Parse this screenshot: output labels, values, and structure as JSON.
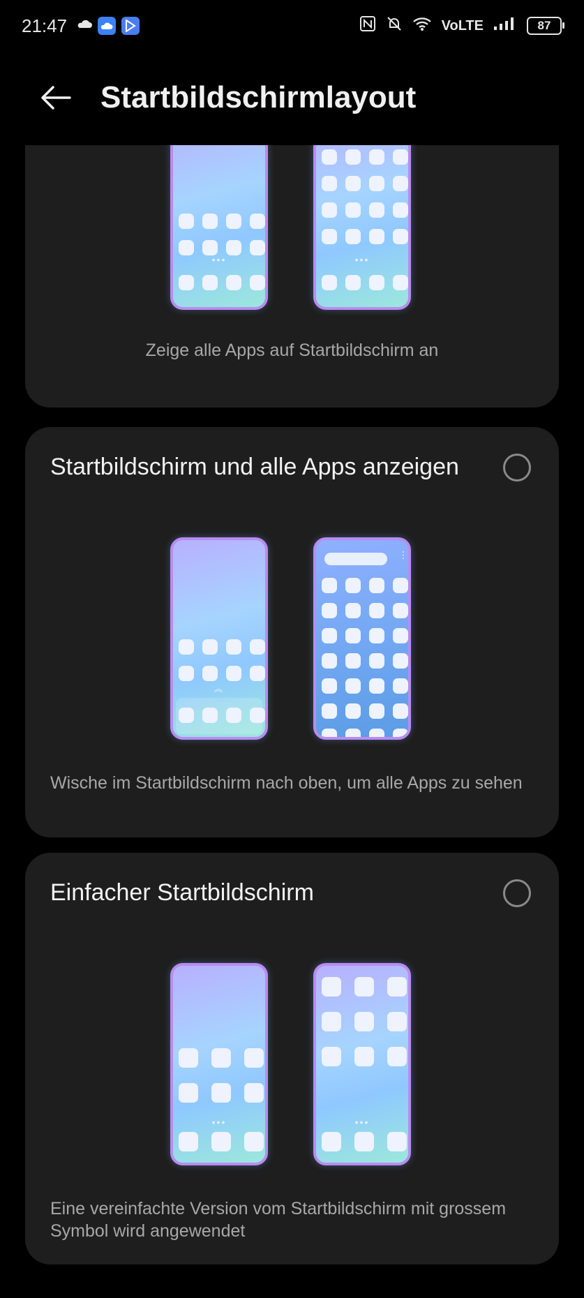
{
  "status_bar": {
    "time": "21:47",
    "left_icons": [
      "weather-cloud-icon",
      "cloud-app-icon",
      "play-store-icon"
    ],
    "right_icons": [
      "nfc-icon",
      "bell-muted-icon",
      "wifi-icon",
      "signal-icon"
    ],
    "volte": "VoLTE",
    "battery": "87"
  },
  "header": {
    "title": "Startbildschirmlayout"
  },
  "options": [
    {
      "title": "",
      "description": "Zeige alle Apps auf Startbildschirm an",
      "selected": false
    },
    {
      "title": "Startbildschirm und alle Apps anzeigen",
      "description": "Wische im Startbildschirm nach oben, um alle Apps zu sehen",
      "selected": false
    },
    {
      "title": "Einfacher Startbildschirm",
      "description": "Eine vereinfachte Version vom Startbildschirm mit grossem Symbol wird angewendet",
      "selected": false
    }
  ],
  "colors": {
    "background": "#000000",
    "card": "#1e1e1e",
    "accent_border": "#b88cf0",
    "text_secondary": "#a8a8a8"
  }
}
